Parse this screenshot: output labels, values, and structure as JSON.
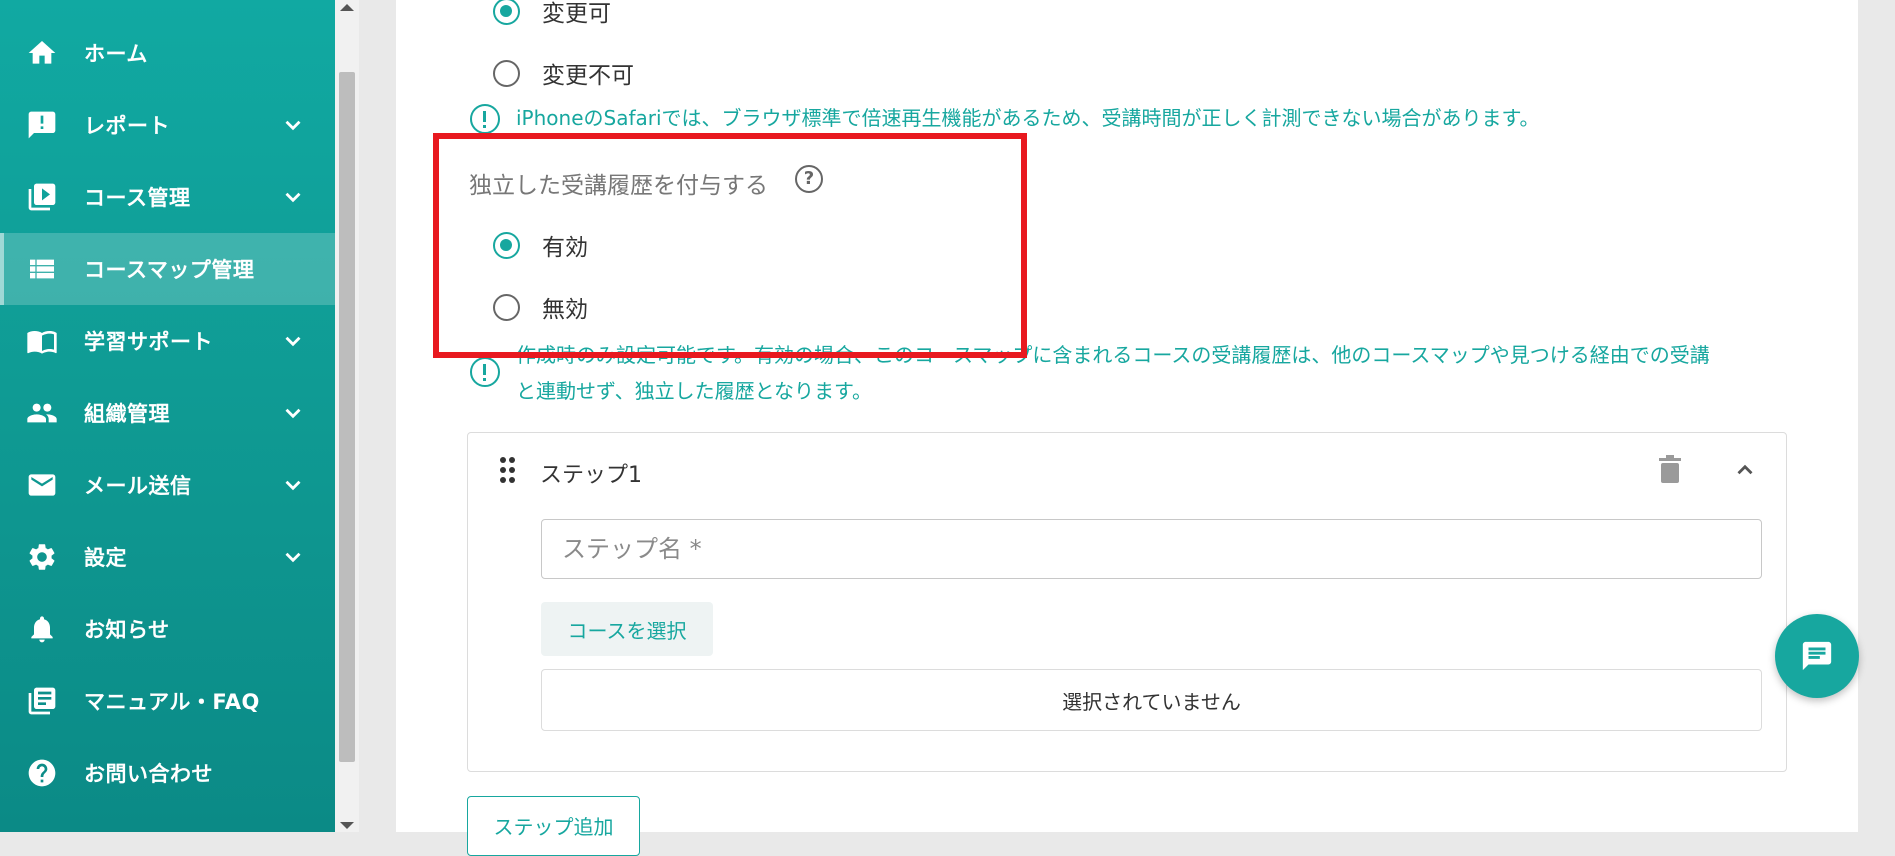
{
  "sidebar": {
    "items": [
      {
        "label": "ホーム",
        "icon": "home-icon"
      },
      {
        "label": "レポート",
        "icon": "report-icon"
      },
      {
        "label": "コース管理",
        "icon": "course-icon"
      },
      {
        "label": "コースマップ管理",
        "icon": "list-icon",
        "active": true
      },
      {
        "label": "学習サポート",
        "icon": "book-icon"
      },
      {
        "label": "組織管理",
        "icon": "people-icon"
      },
      {
        "label": "メール送信",
        "icon": "mail-icon"
      },
      {
        "label": "設定",
        "icon": "gear-icon"
      },
      {
        "label": "お知らせ",
        "icon": "bell-icon"
      },
      {
        "label": "マニュアル・FAQ",
        "icon": "manual-icon"
      },
      {
        "label": "お問い合わせ",
        "icon": "help-circle-icon"
      }
    ]
  },
  "speed_setting": {
    "option_changeable": "変更可",
    "option_not_changeable": "変更不可",
    "note": "iPhoneのSafariでは、ブラウザ標準で倍速再生機能があるため、受講時間が正しく計測できない場合があります。"
  },
  "independent_history": {
    "label": "独立した受講履歴を付与する",
    "help_glyph": "?",
    "option_enabled": "有効",
    "option_disabled": "無効",
    "note_line1": "作成時のみ設定可能です。有効の場合、このコースマップに含まれるコースの受講履歴は、他のコースマップや見つける経由での受講",
    "note_line2": "と連動せず、独立した履歴となります。"
  },
  "step": {
    "title": "ステップ1",
    "name_placeholder": "ステップ名 *",
    "select_course_label": "コースを選択",
    "selected_status": "選択されていません"
  },
  "add_step_label": "ステップ追加",
  "colors": {
    "accent": "#17a79f",
    "highlight": "#e8191f"
  }
}
